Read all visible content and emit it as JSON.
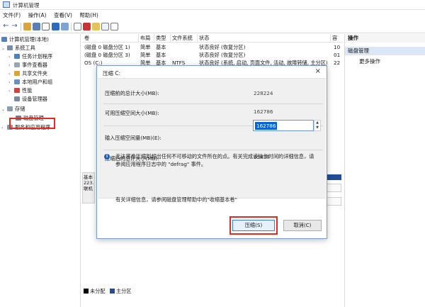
{
  "window": {
    "title": "计算机管理"
  },
  "menu": [
    "文件(F)",
    "操作(A)",
    "查看(V)",
    "帮助(H)"
  ],
  "tree": {
    "root": "计算机管理(本地)",
    "system_tools": "系统工具",
    "task_scheduler": "任务计划程序",
    "event_viewer": "事件查看器",
    "shared_folders": "共享文件夹",
    "local_users": "本地用户和组",
    "performance": "性能",
    "device_manager": "设备管理器",
    "storage": "存储",
    "disk_management": "磁盘管理",
    "services": "服务和应用程序"
  },
  "columns": {
    "volume": "卷",
    "layout": "布局",
    "type": "类型",
    "filesystem": "文件系统",
    "status": "状态",
    "capacity": "容",
    "extra": "可"
  },
  "volumes": [
    {
      "name": "(磁盘 0 磁盘分区 1)",
      "layout": "简单",
      "type": "基本",
      "fs": "",
      "status": "状态良好 (恢复分区)",
      "cap": "10"
    },
    {
      "name": "(磁盘 0 磁盘分区 3)",
      "layout": "简单",
      "type": "基本",
      "fs": "",
      "status": "状态良好 (恢复分区)",
      "cap": "01"
    },
    {
      "name": "OS (C:)",
      "layout": "简单",
      "type": "基本",
      "fs": "NTFS",
      "status": "状态良好 (系统, 启动, 页面文件, 活动, 故障转储, 主分区)",
      "cap": "22"
    }
  ],
  "actions": {
    "header": "操作",
    "section": "磁盘管理",
    "more": "更多操作"
  },
  "disk_panel": {
    "label_lines": [
      "基本",
      "223.",
      "联机"
    ]
  },
  "legend": {
    "unallocated": "未分配",
    "primary": "主分区"
  },
  "dialog": {
    "title": "压缩 C:",
    "total_before_label": "压缩前的总计大小(MB):",
    "total_before_value": "228224",
    "available_label": "可用压缩空间大小(MB):",
    "available_value": "162786",
    "amount_label": "输入压缩空间量(MB)(E):",
    "amount_value": "162786",
    "total_after_label": "压缩后的总计大小(MB):",
    "total_after_value": "65438",
    "info_text": "无法将卷压缩到超出任何不可移动的文件所在的点。有关完成该操作时间的详细信息，请参阅应用程序日志中的 \"defrag\" 事件。",
    "more_info": "有关详细信息，请参阅磁盘管理帮助中的\"收缩基本卷\"",
    "shrink_button": "压缩(S)",
    "cancel_button": "取消(C)"
  },
  "colors": {
    "accent": "#0a64d6",
    "highlight_red": "#e32b1f",
    "primary_partition": "#1f4e9b"
  }
}
